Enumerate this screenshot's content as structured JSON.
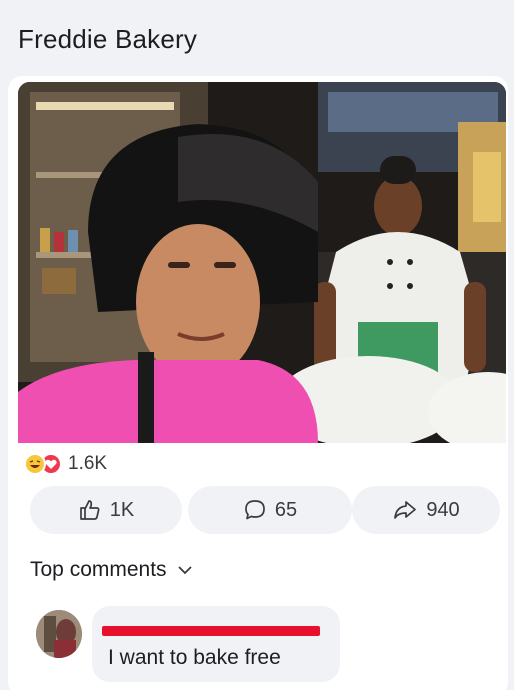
{
  "page": {
    "title": "Freddie Bakery"
  },
  "post": {
    "reactions": {
      "icons": [
        "haha-reaction-icon",
        "love-reaction-icon"
      ],
      "count": "1.6K"
    },
    "actions": {
      "like_count": "1K",
      "comment_count": "65",
      "share_count": "940"
    }
  },
  "comments": {
    "filter_label": "Top comments",
    "items": [
      {
        "author_redacted": true,
        "text": "I want to bake free"
      }
    ]
  },
  "colors": {
    "background": "#f0f2f5",
    "card": "#ffffff",
    "haha": "#f7c63b",
    "love": "#f0384e",
    "redaction": "#e8112d",
    "text_secondary": "#3a3b3c"
  }
}
